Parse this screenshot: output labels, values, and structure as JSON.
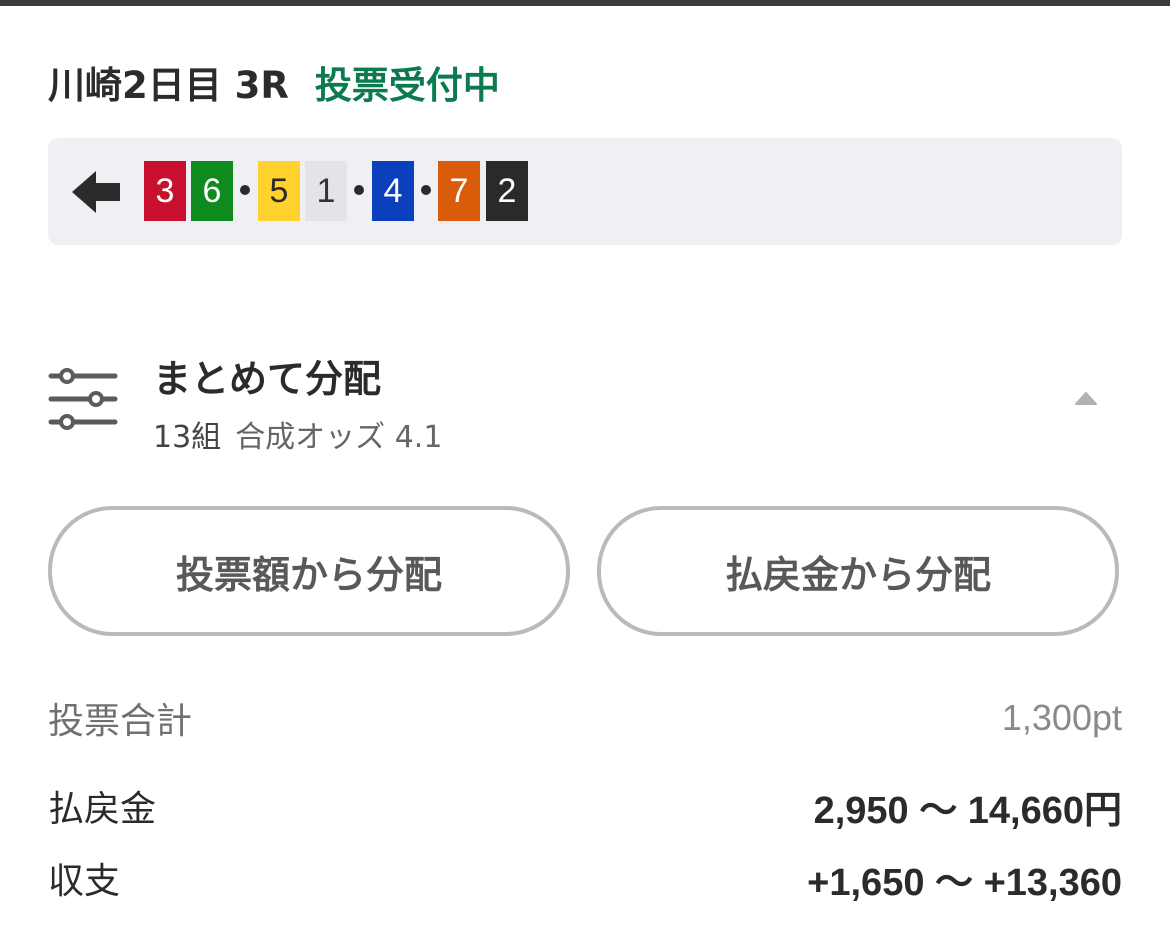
{
  "race": {
    "title": "川崎2日目 3R",
    "status": "投票受付中",
    "status_color": "#0b7a4f"
  },
  "combination": {
    "icon": "arrow-left-icon",
    "numbers": [
      {
        "label": "3",
        "bg": "#c8102e",
        "fg": "#ffffff"
      },
      {
        "label": "6",
        "bg": "#0f8a1f",
        "fg": "#ffffff"
      },
      {
        "label": "5",
        "bg": "#ffd22e",
        "fg": "#2b2b2b"
      },
      {
        "label": "1",
        "bg": "#e4e4e8",
        "fg": "#333333"
      },
      {
        "label": "4",
        "bg": "#0a3fbd",
        "fg": "#ffffff"
      },
      {
        "label": "7",
        "bg": "#d95c0a",
        "fg": "#ffffff"
      },
      {
        "label": "2",
        "bg": "#2a2a2a",
        "fg": "#ffffff"
      }
    ]
  },
  "distribution": {
    "icon": "sliders-icon",
    "title": "まとめて分配",
    "count": "13組",
    "odds_label": "合成オッズ 4.1",
    "toggle_icon": "caret-up-icon"
  },
  "buttons": {
    "by_bet_amount": "投票額から分配",
    "by_payout": "払戻金から分配"
  },
  "summary": {
    "total_label": "投票合計",
    "total_value": "1,300pt",
    "payout_label": "払戻金",
    "payout_value": "2,950 ～ 14,660円",
    "balance_label": "収支",
    "balance_value": "+1,650 ～ +13,360"
  }
}
